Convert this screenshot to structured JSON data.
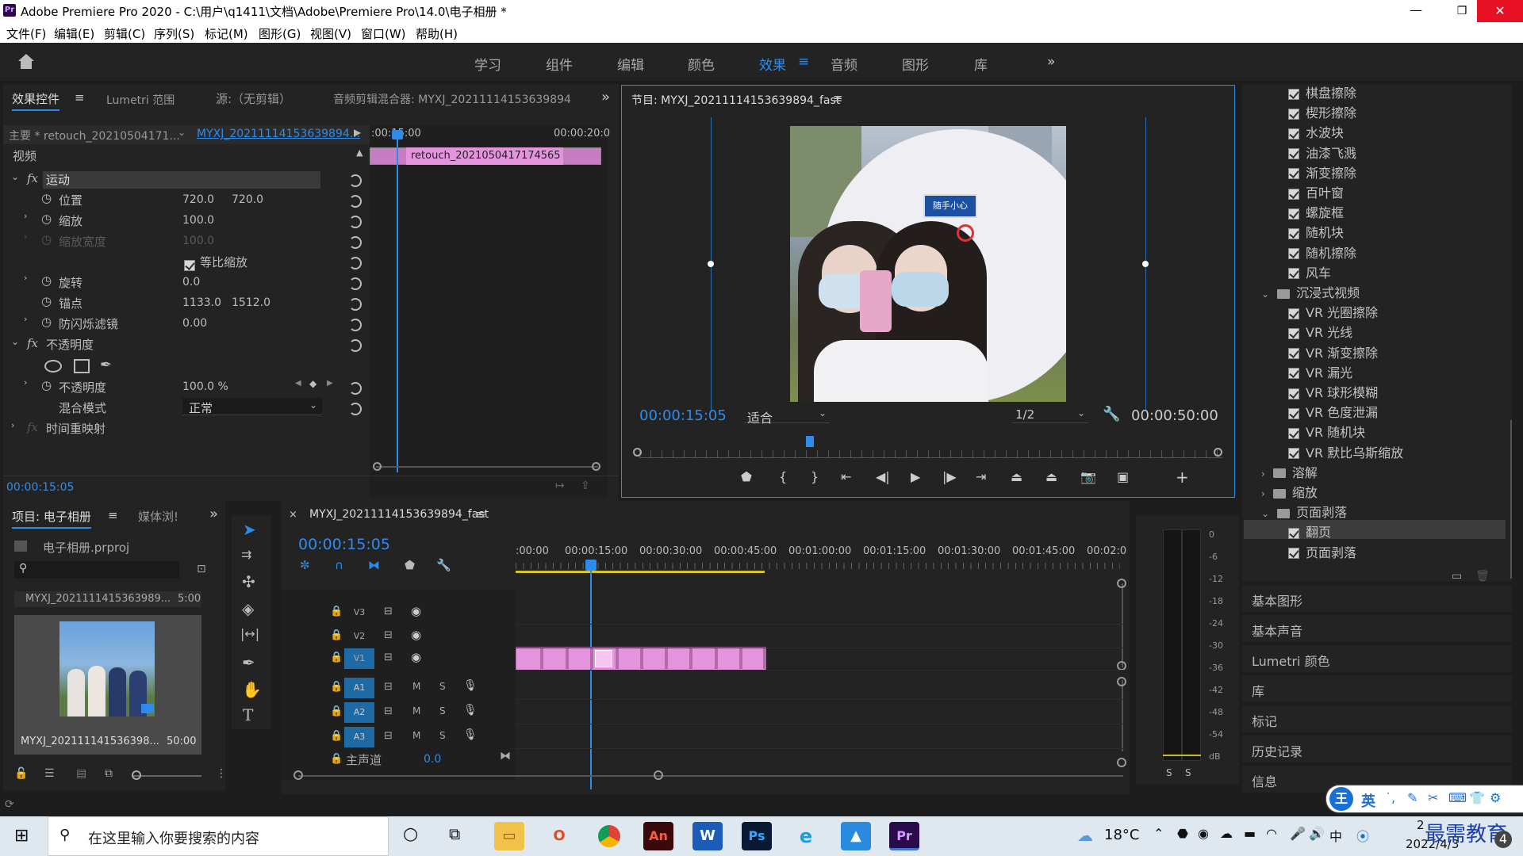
{
  "titlebar": {
    "title": "Adobe Premiere Pro 2020 - C:\\用户\\q1411\\文档\\Adobe\\Premiere Pro\\14.0\\电子相册 *"
  },
  "menu": [
    "文件(F)",
    "编辑(E)",
    "剪辑(C)",
    "序列(S)",
    "标记(M)",
    "图形(G)",
    "视图(V)",
    "窗口(W)",
    "帮助(H)"
  ],
  "workspaces": [
    "学习",
    "组件",
    "编辑",
    "颜色",
    "效果",
    "音频",
    "图形",
    "库"
  ],
  "active_workspace": "效果",
  "effect_controls": {
    "tabs": [
      "效果控件",
      "Lumetri 范围",
      "源:（无剪辑）",
      "音频剪辑混合器: MYXJ_20211114153639894"
    ],
    "master": "主要 * retouch_20210504171...",
    "sequence": "MYXJ_20211114153639894...",
    "ruler": [
      ":00:15:00",
      "00:00:20:0"
    ],
    "clip_name": "retouch_20210504171745​65",
    "section_video": "视频",
    "motion": "运动",
    "position": {
      "label": "位置",
      "x": "720.0",
      "y": "720.0"
    },
    "scale": {
      "label": "缩放",
      "value": "100.0"
    },
    "scale_width": {
      "label": "缩放宽度",
      "value": "100.0"
    },
    "uniform": "等比缩放",
    "rotation": {
      "label": "旋转",
      "value": "0.0"
    },
    "anchor": {
      "label": "锚点",
      "x": "1133.0",
      "y": "1512.0"
    },
    "flicker": {
      "label": "防闪烁滤镜",
      "value": "0.00"
    },
    "opacity_section": "不透明度",
    "opacity": {
      "label": "不透明度",
      "value": "100.0 %"
    },
    "blend": {
      "label": "混合模式",
      "value": "正常"
    },
    "time_remap": "时间重映射",
    "timecode": "00:00:15:05"
  },
  "program": {
    "title": "节目: MYXJ_20211114153639894_fast",
    "timecode": "00:00:15:05",
    "fit": "适合",
    "resolution": "1/2",
    "duration": "00:00:50:00",
    "sign_text": "随手小心"
  },
  "effects_tree": {
    "items_top": [
      "棋盘擦除",
      "楔形擦除",
      "水波块",
      "油漆飞溅",
      "渐变擦除",
      "百叶窗",
      "螺旋框",
      "随机块",
      "随机擦除",
      "风车"
    ],
    "folder_vr": "沉浸式视频",
    "items_vr": [
      "VR 光圈擦除",
      "VR 光线",
      "VR 渐变擦除",
      "VR 漏光",
      "VR 球形模糊",
      "VR 色度泄漏",
      "VR 随机块",
      "VR 默比乌斯缩放"
    ],
    "folder_dissolve": "溶解",
    "folder_zoom": "缩放",
    "folder_page": "页面剥落",
    "items_page": [
      "翻页",
      "页面剥落"
    ],
    "selected": "翻页"
  },
  "side_panels": [
    "基本图形",
    "基本声音",
    "Lumetri 颜色",
    "库",
    "标记",
    "历史记录",
    "信息"
  ],
  "project": {
    "tabs": [
      "项目: 电子相册",
      "媒体浏!"
    ],
    "file": "电子相册.prproj",
    "item1": "MYXJ_20211114153639​89...",
    "item1_dur": "5:00",
    "item2": "MYXJ_202111141536398...",
    "item2_dur": "50:00"
  },
  "timeline": {
    "tab": "MYXJ_20211114153639894_fast",
    "timecode": "00:00:15:05",
    "ruler": [
      ":00:00",
      "00:00:15:00",
      "00:00:30:00",
      "00:00:45:00",
      "00:01:00:00",
      "00:01:15:00",
      "00:01:30:00",
      "00:01:45:00",
      "00:02:0"
    ],
    "tracks_video": [
      "V3",
      "V2",
      "V1"
    ],
    "tracks_audio": [
      "A1",
      "A2",
      "A3"
    ],
    "master": "主声道",
    "master_val": "0.0",
    "m": "M",
    "s": "S"
  },
  "meter": {
    "ticks": [
      "0",
      "-6",
      "-12",
      "-18",
      "-24",
      "-30",
      "-36",
      "-42",
      "-48",
      "-54",
      "dB"
    ],
    "solo": [
      "S",
      "S"
    ]
  },
  "taskbar": {
    "search": "在这里输入你要搜索的内容",
    "temp": "18°C",
    "date": "2022/4/3",
    "time_partial": "2",
    "ime": "英",
    "watermark": "最需教育"
  },
  "colors": {
    "accent": "#2d8ceb",
    "clip": "#e394dc",
    "panel": "#232323"
  }
}
